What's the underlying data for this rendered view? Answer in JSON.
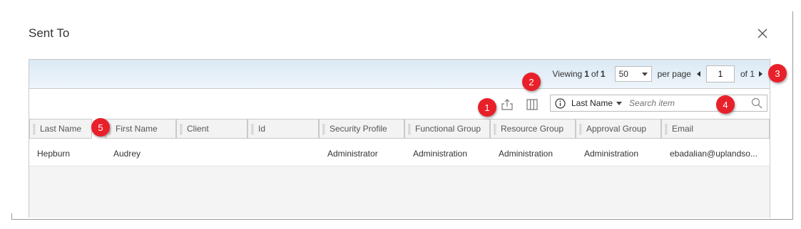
{
  "dialog": {
    "title": "Sent To"
  },
  "pager": {
    "viewing_label": "Viewing",
    "current": "1",
    "of_label": "of",
    "total": "1",
    "per_page_value": "50",
    "per_page_label": "per page",
    "page_value": "1",
    "page_of_label": "of 1"
  },
  "toolbar": {
    "export_icon": "export-icon",
    "columns_icon": "columns-icon",
    "search": {
      "field": "Last Name",
      "placeholder": "Search item",
      "info_icon": "info-icon",
      "search_icon": "magnifier-icon"
    }
  },
  "table": {
    "columns": [
      "Last Name",
      "First Name",
      "Client",
      "Id",
      "Security Profile",
      "Functional Group",
      "Resource Group",
      "Approval Group",
      "Email"
    ],
    "rows": [
      [
        "Hepburn",
        "Audrey",
        "",
        "",
        "Administrator",
        "Administration",
        "Administration",
        "Administration",
        "ebadalian@uplandso..."
      ]
    ]
  },
  "callouts": [
    "1",
    "2",
    "3",
    "4",
    "5"
  ],
  "colors": {
    "callout": "#e8202a",
    "pager_bar": "#dbe9f5",
    "header_bg": "#f3f3f3"
  }
}
